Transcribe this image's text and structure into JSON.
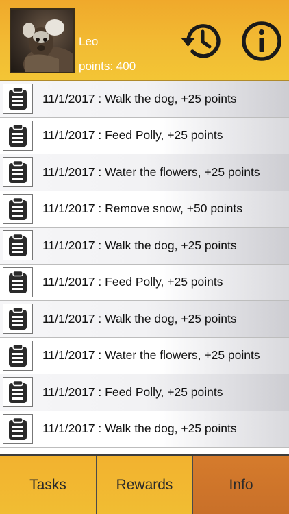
{
  "user": {
    "name": "Leo",
    "points": "points: 400"
  },
  "header": {
    "history_icon": "history-icon",
    "info_icon": "info-icon"
  },
  "tasks": [
    "11/1/2017 : Walk the dog, +25 points",
    "11/1/2017 : Feed Polly, +25 points",
    "11/1/2017 : Water the flowers, +25 points",
    "11/1/2017 : Remove snow, +50 points",
    "11/1/2017 : Walk the dog, +25 points",
    "11/1/2017 : Feed Polly, +25 points",
    "11/1/2017 : Walk the dog, +25 points",
    "11/1/2017 : Water the flowers, +25 points",
    "11/1/2017 : Feed Polly, +25 points",
    "11/1/2017 : Walk the dog, +25 points"
  ],
  "tabs": [
    {
      "label": "Tasks",
      "active": false
    },
    {
      "label": "Rewards",
      "active": false
    },
    {
      "label": "Info",
      "active": true
    }
  ],
  "colors": {
    "header": "#f2bb33",
    "tab": "#f1b832",
    "tab_active": "#cf7529"
  }
}
